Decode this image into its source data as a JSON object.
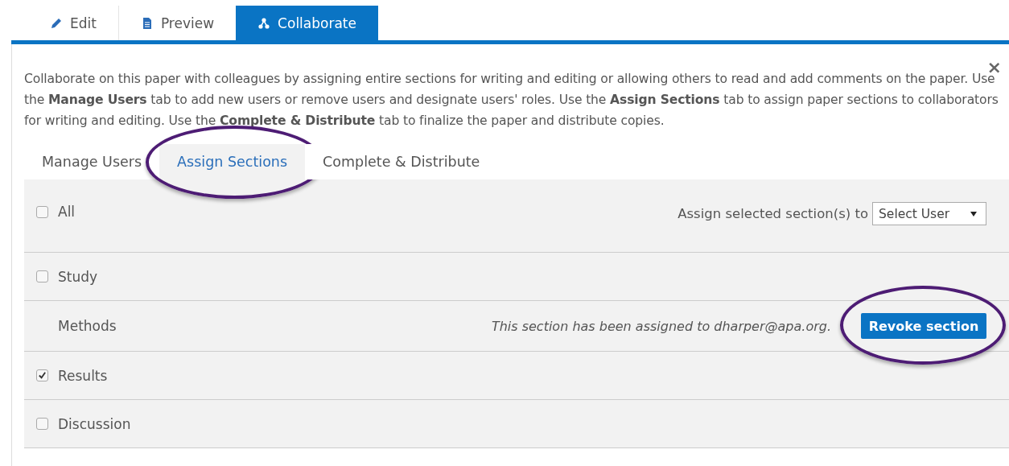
{
  "editor_tabs": [
    {
      "label": "Edit",
      "selected": false
    },
    {
      "label": "Preview",
      "selected": false
    },
    {
      "label": "Collaborate",
      "selected": true
    }
  ],
  "panel": {
    "close": "×",
    "intro": "Collaborate on this paper with colleagues by assigning entire sections for writing and editing or allowing others to read and add comments on the paper. Use the **Manage Users** tab to add new users or remove users and designate users' roles. Use the **Assign Sections** tab to assign paper sections to collaborators for writing and editing. Use the **Complete & Distribute** tab to finalize the paper and distribute copies.",
    "sub_tabs": [
      {
        "label": "Manage Users",
        "selected": false,
        "highlighted": false
      },
      {
        "label": "Assign Sections",
        "selected": true,
        "highlighted": true
      },
      {
        "label": "Complete & Distribute",
        "selected": false,
        "highlighted": false
      }
    ],
    "select_all": {
      "label": "All",
      "checked": false
    },
    "assign_label": "Assign selected section(s) to",
    "user_select": {
      "value": "Select User"
    },
    "rows": [
      {
        "kind": "checkbox",
        "label": "Study",
        "checked": false
      },
      {
        "kind": "assigned",
        "label": "Methods",
        "message": "This section has been assigned to dharper@apa.org.",
        "button": {
          "label": "Revoke section",
          "highlighted": true
        }
      },
      {
        "kind": "checkbox",
        "label": "Results",
        "checked": true
      },
      {
        "kind": "checkbox",
        "label": "Discussion",
        "checked": false
      }
    ]
  }
}
